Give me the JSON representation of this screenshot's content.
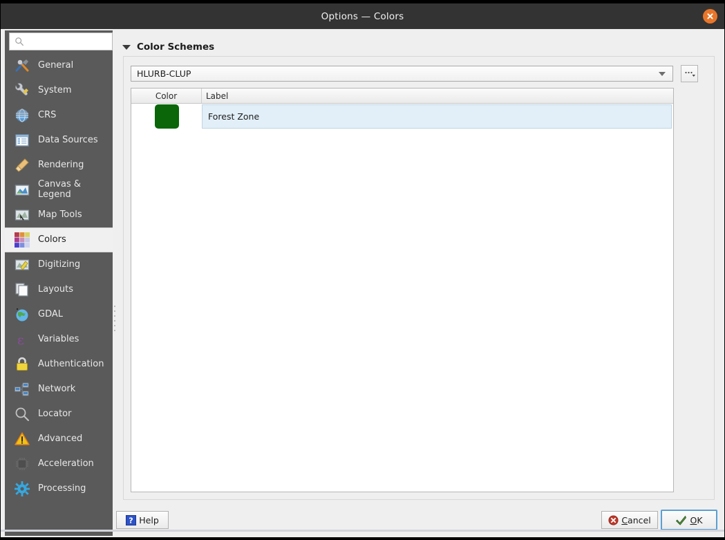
{
  "window": {
    "title": "Options — Colors",
    "close_icon": "close-circle-icon"
  },
  "sidebar": {
    "search": {
      "value": "",
      "placeholder": "",
      "icon": "search-icon"
    },
    "items": [
      {
        "label": "General",
        "icon": "tools-icon",
        "selected": false
      },
      {
        "label": "System",
        "icon": "wrench-gear-icon",
        "selected": false
      },
      {
        "label": "CRS",
        "icon": "globe-grid-icon",
        "selected": false
      },
      {
        "label": "Data Sources",
        "icon": "table-icon",
        "selected": false
      },
      {
        "label": "Rendering",
        "icon": "paintbrush-icon",
        "selected": false
      },
      {
        "label": "Canvas & Legend",
        "icon": "canvas-icon",
        "selected": false
      },
      {
        "label": "Map Tools",
        "icon": "map-tools-icon",
        "selected": false
      },
      {
        "label": "Colors",
        "icon": "color-grid-icon",
        "selected": true
      },
      {
        "label": "Digitizing",
        "icon": "digitizing-icon",
        "selected": false
      },
      {
        "label": "Layouts",
        "icon": "layouts-icon",
        "selected": false
      },
      {
        "label": "GDAL",
        "icon": "gdal-globe-icon",
        "selected": false
      },
      {
        "label": "Variables",
        "icon": "epsilon-icon",
        "selected": false
      },
      {
        "label": "Authentication",
        "icon": "lock-icon",
        "selected": false
      },
      {
        "label": "Network",
        "icon": "network-icon",
        "selected": false
      },
      {
        "label": "Locator",
        "icon": "magnifier-icon",
        "selected": false
      },
      {
        "label": "Advanced",
        "icon": "warning-icon",
        "selected": false
      },
      {
        "label": "Acceleration",
        "icon": "chip-icon",
        "selected": false
      },
      {
        "label": "Processing",
        "icon": "gear-icon",
        "selected": false
      }
    ]
  },
  "main": {
    "group_title": "Color Schemes",
    "scheme_combo": {
      "value": "HLURB-CLUP",
      "arrow_icon": "chevron-down-icon"
    },
    "options_button": {
      "label": "...",
      "icon": "ellipsis-menu-icon"
    },
    "table": {
      "columns": [
        "Color",
        "Label"
      ],
      "rows": [
        {
          "color": "#0a6608",
          "label": "Forest Zone",
          "selected": true
        }
      ]
    },
    "side_tools": [
      {
        "name": "add-color-button",
        "icon": "plus-icon"
      },
      {
        "name": "remove-color-button",
        "icon": "minus-icon"
      },
      {
        "name": "copy-colors-button",
        "icon": "copy-icon"
      },
      {
        "name": "paste-colors-button",
        "icon": "paste-icon"
      },
      {
        "name": "import-colors-button",
        "icon": "open-folder-icon"
      },
      {
        "name": "export-colors-button",
        "icon": "save-disk-icon"
      }
    ]
  },
  "footer": {
    "help": "Help",
    "cancel": "Cancel",
    "ok": "OK",
    "help_icon": "question-badge-icon",
    "cancel_icon": "cancel-x-icon",
    "ok_icon": "check-arrow-icon"
  },
  "colors": {
    "accent_close": "#e8762a",
    "titlebar_bg": "#333333",
    "sidebar_bg": "#5a5a5a",
    "selection_bg": "#e2eff8",
    "swatch_green": "#0a6608",
    "focus_blue": "#5a9fd4"
  }
}
